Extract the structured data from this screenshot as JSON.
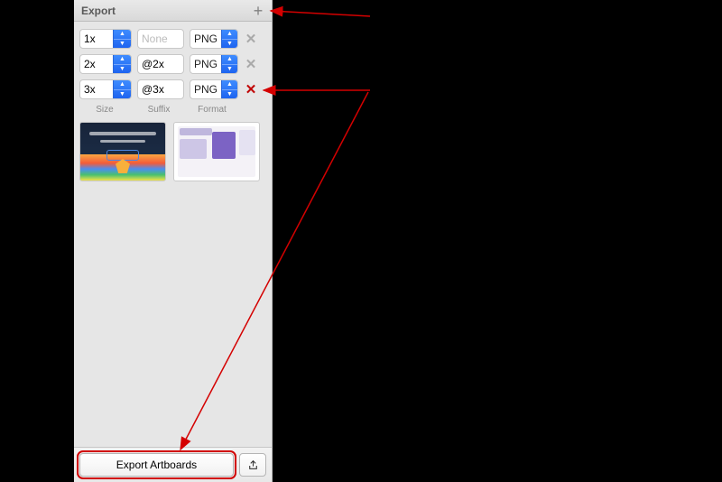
{
  "header": {
    "title": "Export"
  },
  "rows": [
    {
      "size": "1x",
      "suffix": "",
      "placeholder": "None",
      "format": "PNG"
    },
    {
      "size": "2x",
      "suffix": "@2x",
      "placeholder": "",
      "format": "PNG"
    },
    {
      "size": "3x",
      "suffix": "@3x",
      "placeholder": "",
      "format": "PNG"
    }
  ],
  "columnLabels": {
    "size": "Size",
    "suffix": "Suffix",
    "format": "Format"
  },
  "footer": {
    "exportLabel": "Export Artboards"
  },
  "annotations": {
    "arrowColor": "#d40000"
  }
}
